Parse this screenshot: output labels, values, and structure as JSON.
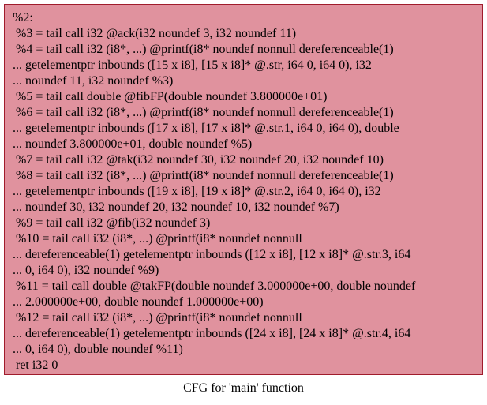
{
  "node": {
    "fill_color": "#e0929e",
    "border_color": "#a01c2c",
    "lines": [
      "%2:",
      " %3 = tail call i32 @ack(i32 noundef 3, i32 noundef 11)",
      " %4 = tail call i32 (i8*, ...) @printf(i8* noundef nonnull dereferenceable(1)",
      "... getelementptr inbounds ([15 x i8], [15 x i8]* @.str, i64 0, i64 0), i32",
      "... noundef 11, i32 noundef %3)",
      " %5 = tail call double @fibFP(double noundef 3.800000e+01)",
      " %6 = tail call i32 (i8*, ...) @printf(i8* noundef nonnull dereferenceable(1)",
      "... getelementptr inbounds ([17 x i8], [17 x i8]* @.str.1, i64 0, i64 0), double",
      "... noundef 3.800000e+01, double noundef %5)",
      " %7 = tail call i32 @tak(i32 noundef 30, i32 noundef 20, i32 noundef 10)",
      " %8 = tail call i32 (i8*, ...) @printf(i8* noundef nonnull dereferenceable(1)",
      "... getelementptr inbounds ([19 x i8], [19 x i8]* @.str.2, i64 0, i64 0), i32",
      "... noundef 30, i32 noundef 20, i32 noundef 10, i32 noundef %7)",
      " %9 = tail call i32 @fib(i32 noundef 3)",
      " %10 = tail call i32 (i8*, ...) @printf(i8* noundef nonnull",
      "... dereferenceable(1) getelementptr inbounds ([12 x i8], [12 x i8]* @.str.3, i64",
      "... 0, i64 0), i32 noundef %9)",
      " %11 = tail call double @takFP(double noundef 3.000000e+00, double noundef",
      "... 2.000000e+00, double noundef 1.000000e+00)",
      " %12 = tail call i32 (i8*, ...) @printf(i8* noundef nonnull",
      "... dereferenceable(1) getelementptr inbounds ([24 x i8], [24 x i8]* @.str.4, i64",
      "... 0, i64 0), double noundef %11)",
      " ret i32 0"
    ]
  },
  "caption": "CFG for 'main' function"
}
